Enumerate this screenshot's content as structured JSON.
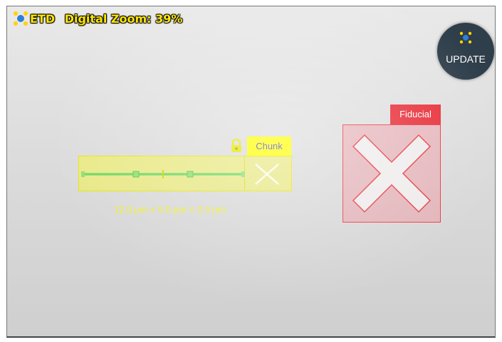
{
  "header": {
    "detector": "ETD",
    "zoom_text": "Digital Zoom: 39%",
    "icon": "detector-icon"
  },
  "update_button": {
    "label": "UPDATE",
    "icon": "update-sparkle-icon"
  },
  "patterns": {
    "chunk": {
      "label": "Chunk",
      "dimensions": "12.0 µm  ×  5.0 µm  ×  2.0 µm",
      "lock_icon": "lock-icon",
      "color": "#ffff00"
    },
    "fiducial": {
      "label": "Fiducial",
      "color": "#e8303a"
    }
  }
}
